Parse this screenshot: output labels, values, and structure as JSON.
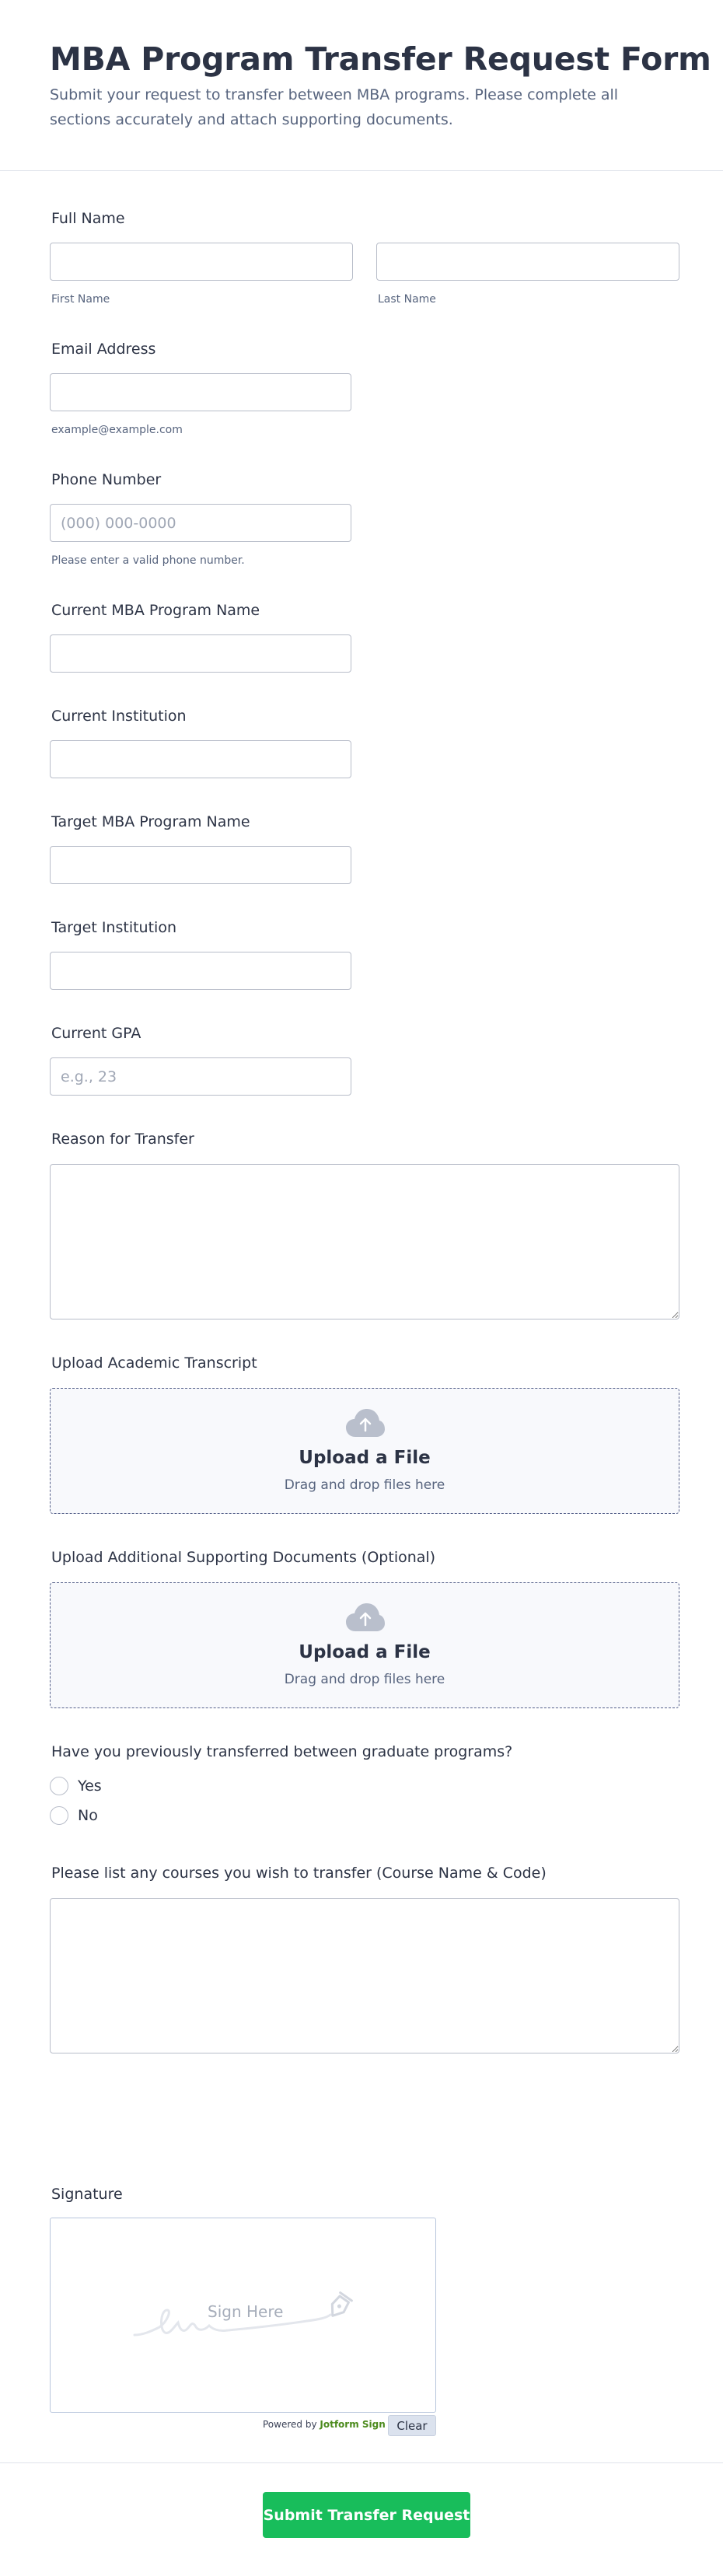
{
  "form": {
    "title": "MBA Program Transfer Request Form",
    "subtitle": "Submit your request to transfer between MBA programs. Please complete all sections accurately and attach supporting documents."
  },
  "full_name": {
    "label": "Full Name",
    "first_value": "",
    "last_value": "",
    "first_sublabel": "First Name",
    "last_sublabel": "Last Name"
  },
  "email": {
    "label": "Email Address",
    "value": "",
    "sublabel": "example@example.com"
  },
  "phone": {
    "label": "Phone Number",
    "value": "",
    "placeholder": "(000) 000-0000",
    "sublabel": "Please enter a valid phone number."
  },
  "current_program": {
    "label": "Current MBA Program Name",
    "value": ""
  },
  "current_institution": {
    "label": "Current Institution",
    "value": ""
  },
  "target_program": {
    "label": "Target MBA Program Name",
    "value": ""
  },
  "target_institution": {
    "label": "Target Institution",
    "value": ""
  },
  "gpa": {
    "label": "Current GPA",
    "value": "",
    "placeholder": "e.g., 23"
  },
  "reason": {
    "label": "Reason for Transfer",
    "value": ""
  },
  "transcript_upload": {
    "label": "Upload Academic Transcript",
    "title": "Upload a File",
    "subtitle": "Drag and drop files here",
    "icon": "cloud-upload-icon"
  },
  "supporting_upload": {
    "label": "Upload Additional Supporting Documents (Optional)",
    "title": "Upload a File",
    "subtitle": "Drag and drop files here",
    "icon": "cloud-upload-icon"
  },
  "previous_transfer": {
    "question": "Have you previously transferred between graduate programs?",
    "options": [
      "Yes",
      "No"
    ],
    "selected": null
  },
  "courses": {
    "label": "Please list any courses you wish to transfer (Course Name & Code)",
    "value": ""
  },
  "signature": {
    "label": "Signature",
    "placeholder": "Sign Here",
    "powered_prefix": "Powered by",
    "powered_brand": "Jotform Sign",
    "clear_label": "Clear"
  },
  "submit": {
    "label": "Submit Transfer Request"
  },
  "colors": {
    "accent": "#18bd5b",
    "text": "#2c3345",
    "muted": "#57647e",
    "border": "#b8bdc9"
  }
}
